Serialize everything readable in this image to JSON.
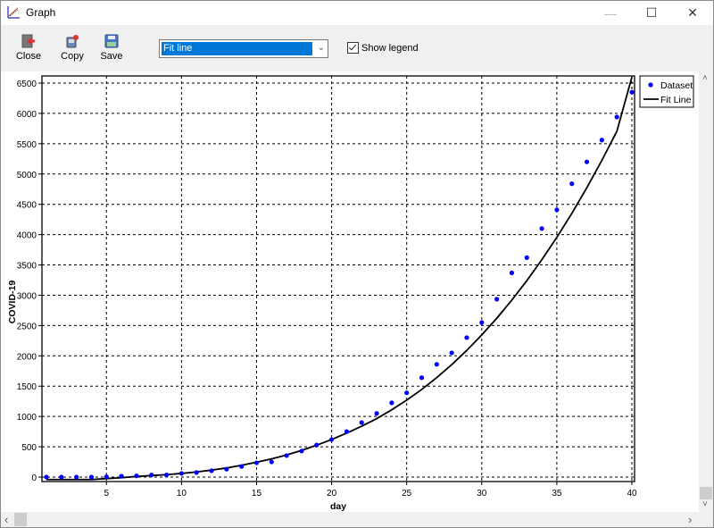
{
  "window": {
    "title": "Graph",
    "icon": "chart-icon",
    "controls": {
      "minimize": "—",
      "maximize": "☐",
      "close": "✕"
    }
  },
  "toolbar": {
    "close_label": "Close",
    "copy_label": "Copy",
    "save_label": "Save",
    "dropdown_value": "Fit line",
    "show_legend_label": "Show legend",
    "show_legend_checked": true
  },
  "colors": {
    "dataset": "#0000ff",
    "fit_line": "#000000",
    "selection": "#0078d7"
  },
  "scrollbars": {
    "up": "˄",
    "down": "˅",
    "left": "‹",
    "right": "›"
  },
  "chart_data": {
    "type": "scatter",
    "title": "",
    "xlabel": "day",
    "ylabel": "COVID-19",
    "xlim": [
      1,
      40
    ],
    "ylim": [
      0,
      6500
    ],
    "xticks": [
      5,
      10,
      15,
      20,
      25,
      30,
      35,
      40
    ],
    "yticks": [
      0,
      500,
      1000,
      1500,
      2000,
      2500,
      3000,
      3500,
      4000,
      4500,
      5000,
      5500,
      6000,
      6500
    ],
    "grid": true,
    "legend_position": "top-right-outside",
    "legend": [
      "Dataset",
      "Fit Line"
    ],
    "series": [
      {
        "name": "Dataset",
        "kind": "points",
        "x": [
          1,
          2,
          3,
          4,
          5,
          6,
          7,
          8,
          9,
          10,
          11,
          12,
          13,
          14,
          15,
          16,
          17,
          18,
          19,
          20,
          21,
          22,
          23,
          24,
          25,
          26,
          27,
          28,
          29,
          30,
          31,
          32,
          33,
          34,
          35,
          36,
          37,
          38,
          39,
          40
        ],
        "y": [
          0,
          0,
          0,
          0,
          5,
          15,
          20,
          35,
          35,
          60,
          75,
          105,
          130,
          175,
          235,
          250,
          355,
          430,
          530,
          620,
          750,
          900,
          1050,
          1225,
          1390,
          1640,
          1860,
          2050,
          2300,
          2550,
          2935,
          3370,
          3620,
          4100,
          4410,
          4840,
          5200,
          5560,
          5940,
          6350
        ]
      },
      {
        "name": "Fit Line",
        "kind": "line",
        "x": [
          1,
          2,
          3,
          4,
          5,
          6,
          7,
          8,
          9,
          10,
          11,
          12,
          13,
          14,
          15,
          16,
          17,
          18,
          19,
          20,
          21,
          22,
          23,
          24,
          25,
          26,
          27,
          28,
          29,
          30,
          31,
          32,
          33,
          34,
          35,
          36,
          37,
          38,
          39,
          40
        ],
        "y": [
          -40,
          -40,
          -40,
          -40,
          -25,
          -10,
          10,
          25,
          40,
          60,
          85,
          115,
          150,
          195,
          245,
          300,
          365,
          440,
          525,
          620,
          725,
          840,
          965,
          1110,
          1270,
          1445,
          1640,
          1855,
          2090,
          2345,
          2620,
          2920,
          3240,
          3585,
          3955,
          4350,
          4775,
          5225,
          5705,
          6600
        ]
      }
    ]
  }
}
